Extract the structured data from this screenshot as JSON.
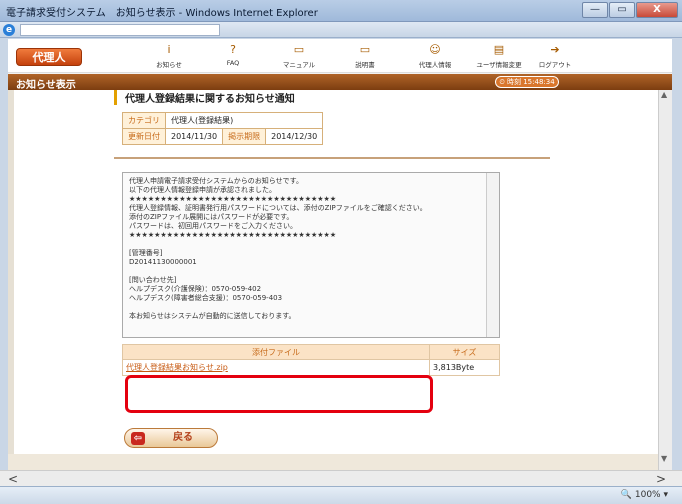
{
  "window": {
    "title": "電子請求受付システム　お知らせ表示 - Windows Internet Explorer",
    "min": "—",
    "max": "▭",
    "close": "X"
  },
  "nav": {
    "role": "代理人",
    "items": [
      {
        "label": "お知らせ",
        "icon": "i"
      },
      {
        "label": "FAQ",
        "icon": "?"
      },
      {
        "label": "マニュアル",
        "icon": "▭"
      },
      {
        "label": "説明書",
        "icon": "▭"
      },
      {
        "label": "代理人情報",
        "icon": "☺"
      },
      {
        "label": "ユーザ情報変更",
        "icon": "▤"
      },
      {
        "label": "ログアウト",
        "icon": "➔"
      }
    ]
  },
  "breadcrumb": "お知らせ表示",
  "clock": "⏲ 時刻 15:48:34",
  "page_title": "代理人登録結果に関するお知らせ通知",
  "meta": {
    "category_label": "カテゴリ",
    "category_value": "代理人(登録結果)",
    "updated_label": "更新日付",
    "updated_value": "2014/11/30",
    "period_label": "掲示期限",
    "period_value": "2014/12/30"
  },
  "message": "代理人申請電子請求受付システムからのお知らせです。\n以下の代理人情報登録申請が承認されました。\n★★★★★★★★★★★★★★★★★★★★★★★★★★★★★★★★★\n代理人登録情報、証明書発行用パスワードについては、添付のZIPファイルをご確認ください。\n添付のZIPファイル展開にはパスワードが必要です。\nパスワードは、初回用パスワードをご入力ください。\n★★★★★★★★★★★★★★★★★★★★★★★★★★★★★★★★★\n\n[管理番号]\nD20141130000001\n\n[問い合わせ先]\nヘルプデスク(介護保険)：0570-059-402\nヘルプデスク(障害者総合支援)：0570-059-403\n\n本お知らせはシステムが自動的に送信しております。",
  "attachments": {
    "header_file": "添付ファイル",
    "header_size": "サイズ",
    "rows": [
      {
        "name": "代理人登録結果お知らせ.zip",
        "size": "3,813Byte"
      }
    ]
  },
  "back_button": "戻る",
  "status": {
    "zoom": "100%"
  },
  "colors": {
    "accent": "#c4410c",
    "highlight": "#e4000f"
  }
}
